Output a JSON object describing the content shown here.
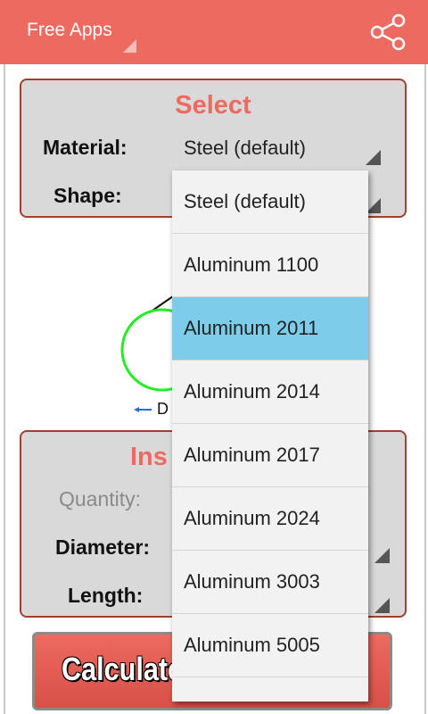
{
  "action_bar": {
    "title": "Free Apps",
    "share_icon": "share-icon",
    "color": "#ec6a60"
  },
  "select_panel": {
    "title": "Select",
    "material_label": "Material:",
    "material_value": "Steel (default)",
    "shape_label": "Shape:"
  },
  "diagram": {
    "dimension_label": "D"
  },
  "input_panel": {
    "title_visible": "Ins",
    "quantity_label": "Quantity:",
    "diameter_label": "Diameter:",
    "length_label": "Length:"
  },
  "calculate_button": {
    "label": "Calculate"
  },
  "dropdown": {
    "selected_index": 2,
    "highlight_color": "#7dcdea",
    "items": [
      "Steel (default)",
      "Aluminum 1100",
      "Aluminum 2011",
      "Aluminum 2014",
      "Aluminum 2017",
      "Aluminum 2024",
      "Aluminum 3003",
      "Aluminum 5005"
    ]
  }
}
